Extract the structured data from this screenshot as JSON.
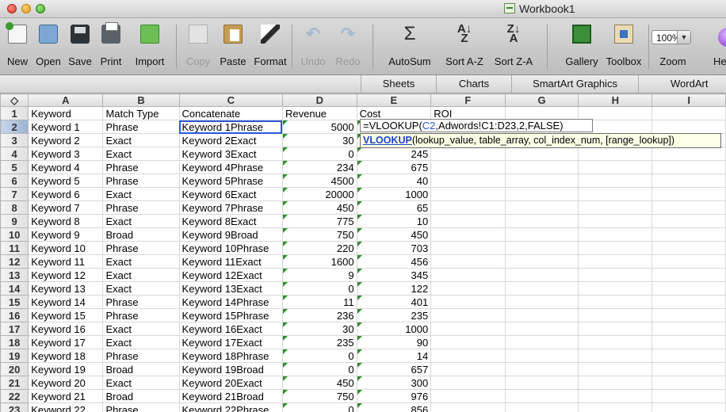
{
  "window": {
    "title": "Workbook1"
  },
  "toolbar": {
    "buttons": [
      {
        "label": "New"
      },
      {
        "label": "Open"
      },
      {
        "label": "Save"
      },
      {
        "label": "Print"
      },
      {
        "label": "Import"
      },
      {
        "label": "Copy"
      },
      {
        "label": "Paste"
      },
      {
        "label": "Format"
      },
      {
        "label": "Undo"
      },
      {
        "label": "Redo"
      },
      {
        "label": "AutoSum"
      },
      {
        "label": "Sort A-Z"
      },
      {
        "label": "Sort Z-A"
      },
      {
        "label": "Gallery"
      },
      {
        "label": "Toolbox"
      },
      {
        "label": "Zoom"
      },
      {
        "label": "He"
      }
    ],
    "zoom_value": "100%"
  },
  "ribbon": {
    "tabs": [
      "Sheets",
      "Charts",
      "SmartArt Graphics",
      "WordArt"
    ]
  },
  "sheet": {
    "corner_label": "◇",
    "column_letters": [
      "A",
      "B",
      "C",
      "D",
      "E",
      "F",
      "G",
      "H",
      "I"
    ],
    "active_cell": "E2",
    "rows": [
      {
        "n": "1",
        "a": "Keyword",
        "b": "Match Type",
        "c": "Concatenate",
        "d": "Revenue",
        "e": "Cost",
        "f": "ROI"
      },
      {
        "n": "2",
        "a": "Keyword 1",
        "b": "Phrase",
        "c": "Keyword 1Phrase",
        "d": "5000",
        "e": ""
      },
      {
        "n": "3",
        "a": "Keyword 2",
        "b": "Exact",
        "c": "Keyword 2Exact",
        "d": "30",
        "e": ""
      },
      {
        "n": "4",
        "a": "Keyword 3",
        "b": "Exact",
        "c": "Keyword 3Exact",
        "d": "0",
        "e": "245"
      },
      {
        "n": "5",
        "a": "Keyword 4",
        "b": "Phrase",
        "c": "Keyword 4Phrase",
        "d": "234",
        "e": "675"
      },
      {
        "n": "6",
        "a": "Keyword 5",
        "b": "Phrase",
        "c": "Keyword 5Phrase",
        "d": "4500",
        "e": "40"
      },
      {
        "n": "7",
        "a": "Keyword 6",
        "b": "Exact",
        "c": "Keyword 6Exact",
        "d": "20000",
        "e": "1000"
      },
      {
        "n": "8",
        "a": "Keyword 7",
        "b": "Phrase",
        "c": "Keyword 7Phrase",
        "d": "450",
        "e": "65"
      },
      {
        "n": "9",
        "a": "Keyword 8",
        "b": "Exact",
        "c": "Keyword 8Exact",
        "d": "775",
        "e": "10"
      },
      {
        "n": "10",
        "a": "Keyword 9",
        "b": "Broad",
        "c": "Keyword 9Broad",
        "d": "750",
        "e": "450"
      },
      {
        "n": "11",
        "a": "Keyword 10",
        "b": "Phrase",
        "c": "Keyword 10Phrase",
        "d": "220",
        "e": "703"
      },
      {
        "n": "12",
        "a": "Keyword 11",
        "b": "Exact",
        "c": "Keyword 11Exact",
        "d": "1600",
        "e": "456"
      },
      {
        "n": "13",
        "a": "Keyword 12",
        "b": "Exact",
        "c": "Keyword 12Exact",
        "d": "9",
        "e": "345"
      },
      {
        "n": "14",
        "a": "Keyword 13",
        "b": "Exact",
        "c": "Keyword 13Exact",
        "d": "0",
        "e": "122"
      },
      {
        "n": "15",
        "a": "Keyword 14",
        "b": "Phrase",
        "c": "Keyword 14Phrase",
        "d": "11",
        "e": "401"
      },
      {
        "n": "16",
        "a": "Keyword 15",
        "b": "Phrase",
        "c": "Keyword 15Phrase",
        "d": "236",
        "e": "235"
      },
      {
        "n": "17",
        "a": "Keyword 16",
        "b": "Exact",
        "c": "Keyword 16Exact",
        "d": "30",
        "e": "1000"
      },
      {
        "n": "18",
        "a": "Keyword 17",
        "b": "Exact",
        "c": "Keyword 17Exact",
        "d": "235",
        "e": "90"
      },
      {
        "n": "19",
        "a": "Keyword 18",
        "b": "Phrase",
        "c": "Keyword 18Phrase",
        "d": "0",
        "e": "14"
      },
      {
        "n": "20",
        "a": "Keyword 19",
        "b": "Broad",
        "c": "Keyword 19Broad",
        "d": "0",
        "e": "657"
      },
      {
        "n": "21",
        "a": "Keyword 20",
        "b": "Exact",
        "c": "Keyword 20Exact",
        "d": "450",
        "e": "300"
      },
      {
        "n": "22",
        "a": "Keyword 21",
        "b": "Broad",
        "c": "Keyword 21Broad",
        "d": "750",
        "e": "976"
      },
      {
        "n": "23",
        "a": "Keyword 22",
        "b": "Phrase",
        "c": "Keyword 22Phrase",
        "d": "0",
        "e": "856"
      }
    ]
  },
  "formula_edit": {
    "prefix": "=VLOOKUP(",
    "ref1": "C2",
    "rest": ",Adwords!C1:D23,2,FALSE)"
  },
  "tooltip": {
    "function_name": "VLOOKUP",
    "arguments": "(lookup_value, table_array, col_index_num, [range_lookup])"
  }
}
